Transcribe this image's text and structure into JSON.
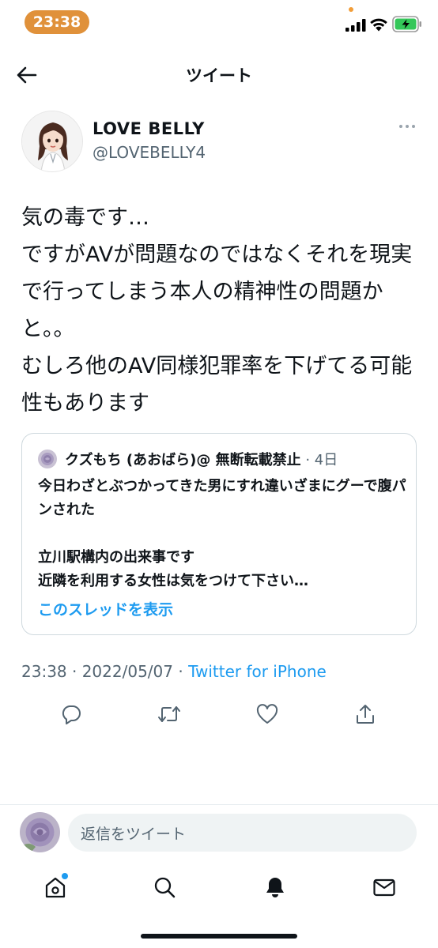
{
  "status_bar": {
    "time": "23:38"
  },
  "header": {
    "title": "ツイート",
    "back_icon": "arrow-left-icon"
  },
  "tweet": {
    "display_name": "LOVE BELLY",
    "handle": "@LOVEBELLY4",
    "text": "気の毒です…\nですがAVが問題なのではなくそれを現実で行ってしまう本人の精神性の問題かと。。\nむしろ他のAV同様犯罪率を下げてる可能性もあります",
    "timestamp": "23:38 · 2022/05/07 · ",
    "source": "Twitter for iPhone"
  },
  "quoted_tweet": {
    "name": "クズもち (あおばら)@ 無断転載禁止",
    "date": " · 4日",
    "text": "今日わざとぶつかってきた男にすれ違いざまにグーで腹パンされた\n\n立川駅構内の出来事です\n近隣を利用する女性は気をつけて下さい…",
    "show_thread": "このスレッドを表示"
  },
  "reply_bar": {
    "placeholder": "返信をツイート"
  },
  "colors": {
    "accent": "#1d9bf0",
    "time_pill": "#e0913a",
    "secondary_text": "#536471"
  },
  "icons": {
    "actions": [
      "reply-icon",
      "retweet-icon",
      "like-icon",
      "share-icon"
    ],
    "tabs": [
      "home-icon",
      "search-icon",
      "notifications-icon",
      "messages-icon"
    ]
  }
}
